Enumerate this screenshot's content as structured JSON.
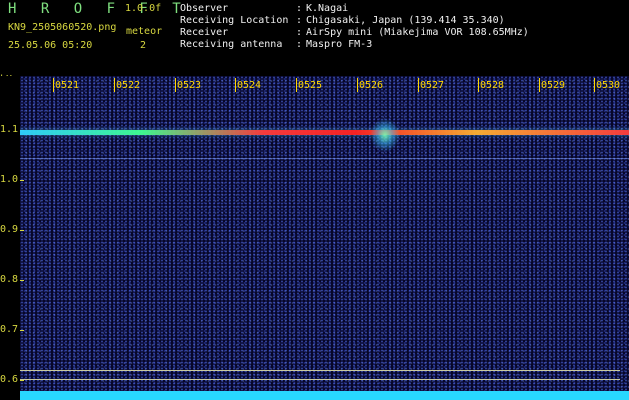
{
  "header": {
    "brand": "H R O F F T",
    "version": "1.0.0f",
    "filename": "KN9_2505060520.png",
    "mode_label": "meteor",
    "timestamp": "25.05.06 05:20",
    "mode_value": "2",
    "meta": [
      {
        "label": "Observer",
        "value": "K.Nagai"
      },
      {
        "label": "Receiving Location",
        "value": "Chigasaki, Japan (139.414 35.340)"
      },
      {
        "label": "Receiver",
        "value": "AirSpy mini (Miakejima VOR 108.65MHz)"
      },
      {
        "label": "Receiving antenna",
        "value": "Maspro FM-3"
      }
    ],
    "separator": ":"
  },
  "plot": {
    "y_unit": "kHz",
    "y_ticks": [
      "1.1",
      "1.0",
      "0.9",
      "0.8",
      "0.7",
      "0.6"
    ],
    "x_ticks": [
      "0521",
      "0522",
      "0523",
      "0524",
      "0525",
      "0526",
      "0527",
      "0528",
      "0529",
      "0530"
    ],
    "colors": {
      "background": "#07072a",
      "signal": "#ff2020",
      "band": "#28d8ff",
      "labels": "#ffd700"
    }
  }
}
